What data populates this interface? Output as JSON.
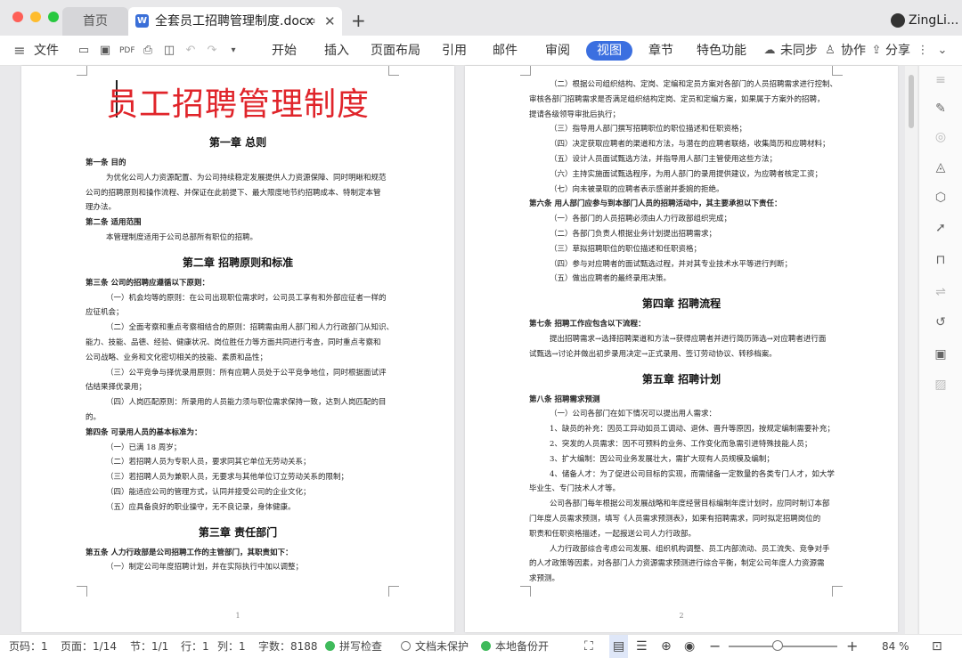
{
  "tabs": {
    "home": "首页",
    "doc_title": "全套员工招聘管理制度.docx",
    "user": "ZingLi..."
  },
  "toolbar": {
    "file": "文件",
    "menus": [
      "开始",
      "插入",
      "页面布局",
      "引用",
      "邮件",
      "审阅",
      "视图",
      "章节",
      "特色功能"
    ],
    "active_menu": "视图",
    "sync": "未同步",
    "collab": "协作",
    "share": "分享"
  },
  "page1": {
    "title": "员工招聘管理制度",
    "page_number": "1",
    "lines": [
      {
        "t": "第一章  总则",
        "k": "ch"
      },
      {
        "t": "第一条    目的",
        "k": "b"
      },
      {
        "t": "为优化公司人力资源配置、为公司持续稳定发展提供人力资源保障、同时明晰和规范",
        "k": "i"
      },
      {
        "t": "公司的招聘原则和操作流程、并保证在此前提下、最大限度地节约招聘成本、特制定本管",
        "k": "n"
      },
      {
        "t": "理办法。",
        "k": "n"
      },
      {
        "t": "第二条    适用范围",
        "k": "b"
      },
      {
        "t": "本管理制度适用于公司总部所有职位的招聘。",
        "k": "i"
      },
      {
        "t": "第二章  招聘原则和标准",
        "k": "ch"
      },
      {
        "t": "第三条    公司的招聘应遵循以下原则：",
        "k": "b"
      },
      {
        "t": "（一）机会均等的原则：在公司出现职位需求时，公司员工享有和外部应征者一样的",
        "k": "i2"
      },
      {
        "t": "应征机会；",
        "k": "n"
      },
      {
        "t": "（二）全面考察和重点考察相结合的原则：招聘需由用人部门和人力行政部门从知识、",
        "k": "i2"
      },
      {
        "t": "能力、技能、品德、经验、健康状况、岗位胜任力等方面共同进行考查，同时重点考察和",
        "k": "n"
      },
      {
        "t": "公司战略、业务和文化密切相关的技能、素质和品性；",
        "k": "n"
      },
      {
        "t": "（三）公平竞争与择优录用原则：所有应聘人员处于公平竞争地位，同时根据面试评",
        "k": "i2"
      },
      {
        "t": "估结果择优录用；",
        "k": "n"
      },
      {
        "t": "（四）人岗匹配原则：所录用的人员能力须与职位需求保持一致，达到人岗匹配的目",
        "k": "i2"
      },
      {
        "t": "的。",
        "k": "n"
      },
      {
        "t": "第四条    可录用人员的基本标准为：",
        "k": "b"
      },
      {
        "t": "（一）已满 18 周岁；",
        "k": "i2"
      },
      {
        "t": "（二）若招聘人员为专职人员，要求同其它单位无劳动关系；",
        "k": "i2"
      },
      {
        "t": "（三）若招聘人员为兼职人员，无要求与其他单位订立劳动关系的限制；",
        "k": "i2"
      },
      {
        "t": "（四）能适应公司的管理方式，认同并接受公司的企业文化；",
        "k": "i2"
      },
      {
        "t": "（五）应具备良好的职业操守，无不良记录，身体健康。",
        "k": "i2"
      },
      {
        "t": "第三章  责任部门",
        "k": "ch"
      },
      {
        "t": "第五条    人力行政部是公司招聘工作的主管部门，其职责如下：",
        "k": "b"
      },
      {
        "t": "（一）制定公司年度招聘计划，并在实际执行中加以调整；",
        "k": "i2"
      }
    ]
  },
  "page2": {
    "page_number": "2",
    "lines": [
      {
        "t": "（二）根据公司组织结构、定岗、定编和定员方案对各部门的人员招聘需求进行控制、",
        "k": "i2"
      },
      {
        "t": "审核各部门招聘需求是否满足组织结构定岗、定员和定编方案，如果属于方案外的招聘，",
        "k": "n"
      },
      {
        "t": "提请各级领导审批后执行；",
        "k": "n"
      },
      {
        "t": "（三）指导用人部门撰写招聘职位的职位描述和任职资格；",
        "k": "i2"
      },
      {
        "t": "（四）决定获取应聘者的渠道和方法，与潜在的应聘者联络，收集简历和应聘材料；",
        "k": "i2"
      },
      {
        "t": "（五）设计人员面试甄选方法，并指导用人部门主管使用这些方法；",
        "k": "i2"
      },
      {
        "t": "（六）主持实施面试甄选程序，为用人部门的录用提供建议，为应聘者核定工资；",
        "k": "i2"
      },
      {
        "t": "（七）向未被录取的应聘者表示感谢并委婉的拒绝。",
        "k": "i2"
      },
      {
        "t": "第六条    用人部门应参与到本部门人员的招聘活动中，其主要承担以下责任：",
        "k": "b"
      },
      {
        "t": "（一）各部门的人员招聘必须由人力行政部组织完成；",
        "k": "i2"
      },
      {
        "t": "（二）各部门负责人根据业务计划提出招聘需求；",
        "k": "i2"
      },
      {
        "t": "（三）草拟招聘职位的职位描述和任职资格；",
        "k": "i2"
      },
      {
        "t": "（四）参与对应聘者的面试甄选过程，并对其专业技术水平等进行判断；",
        "k": "i2"
      },
      {
        "t": "（五）做出应聘者的最终录用决策。",
        "k": "i2"
      },
      {
        "t": "第四章  招聘流程",
        "k": "ch"
      },
      {
        "t": "第七条    招聘工作应包含以下流程：",
        "k": "b"
      },
      {
        "t": "提出招聘需求→选择招聘渠道和方法→获得应聘者并进行简历筛选→对应聘者进行面",
        "k": "i"
      },
      {
        "t": "试甄选→讨论并做出初步录用决定→正式录用、签订劳动协议、转移档案。",
        "k": "n"
      },
      {
        "t": "第五章  招聘计划",
        "k": "ch"
      },
      {
        "t": "第八条    招聘需求预测",
        "k": "b"
      },
      {
        "t": "（一）公司各部门在如下情况可以提出用人需求：",
        "k": "i2"
      },
      {
        "t": "1、缺员的补充：因员工异动如员工调动、退休、晋升等原因，按规定编制需要补充；",
        "k": "i"
      },
      {
        "t": "2、突发的人员需求：因不可预料的业务、工作变化而急需引进特殊技能人员；",
        "k": "i"
      },
      {
        "t": "3、扩大编制：因公司业务发展壮大，需扩大现有人员规模及编制；",
        "k": "i"
      },
      {
        "t": "4、储备人才：为了促进公司目标的实现，而需储备一定数量的各类专门人才，如大学",
        "k": "i"
      },
      {
        "t": "毕业生、专门技术人才等。",
        "k": "n"
      },
      {
        "t": "公司各部门每年根据公司发展战略和年度经营目标编制年度计划时，应同时制订本部",
        "k": "i"
      },
      {
        "t": "门年度人员需求预测，填写《人员需求预测表》，如果有招聘需求，同时拟定招聘岗位的",
        "k": "n"
      },
      {
        "t": "职责和任职资格描述，一起报送公司人力行政部。",
        "k": "n"
      },
      {
        "t": "人力行政部综合考虑公司发展、组织机构调整、员工内部流动、员工流失、竞争对手",
        "k": "i"
      },
      {
        "t": "的人才政策等因素，对各部门人力资源需求预测进行综合平衡，制定公司年度人力资源需",
        "k": "n"
      },
      {
        "t": "求预测。",
        "k": "n"
      }
    ]
  },
  "status": {
    "page_label": "页码：1",
    "pages": "页面：1/14",
    "section": "节：1/1",
    "row": "行：1",
    "col": "列：1",
    "words": "字数：8188",
    "spell": "拼写检查",
    "protect": "文档未保护",
    "backup": "本地备份开",
    "zoom": "84 %",
    "zoom_level": 0.45
  },
  "colors": {
    "accent": "#3b6fe0",
    "title_red": "#e0242a",
    "spell": "#3fba5b"
  }
}
